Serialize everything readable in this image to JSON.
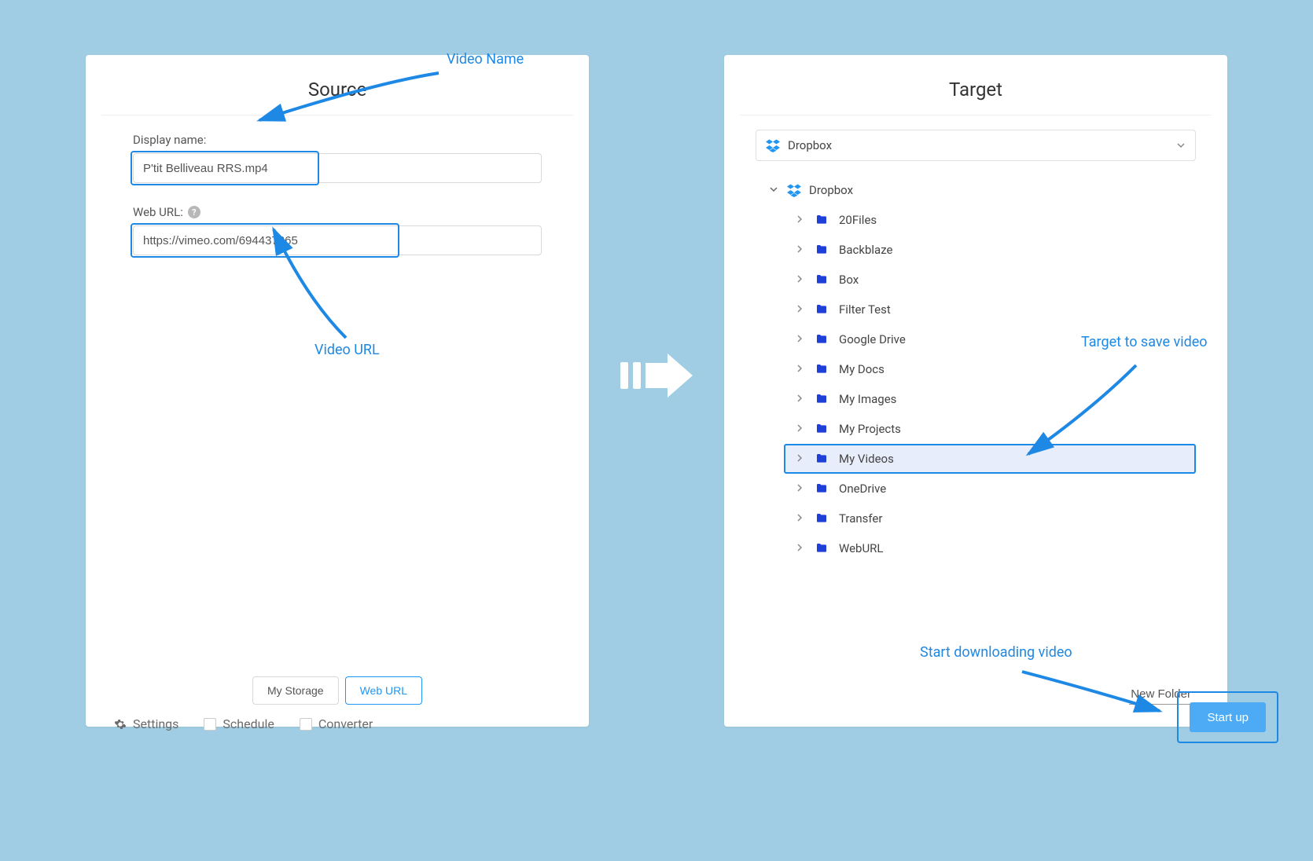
{
  "source": {
    "title": "Source",
    "display_name_label": "Display name:",
    "display_name_value": "P'tit Belliveau RRS.mp4",
    "web_url_label": "Web URL:",
    "web_url_value": "https://vimeo.com/694437265",
    "tabs": {
      "my_storage": "My Storage",
      "web_url": "Web URL"
    }
  },
  "target": {
    "title": "Target",
    "selected_provider": "Dropbox",
    "root_label": "Dropbox",
    "folders": [
      {
        "name": "20Files",
        "selected": false
      },
      {
        "name": "Backblaze",
        "selected": false
      },
      {
        "name": "Box",
        "selected": false
      },
      {
        "name": "Filter Test",
        "selected": false
      },
      {
        "name": "Google Drive",
        "selected": false
      },
      {
        "name": "My Docs",
        "selected": false
      },
      {
        "name": "My Images",
        "selected": false
      },
      {
        "name": "My Projects",
        "selected": false
      },
      {
        "name": "My Videos",
        "selected": true
      },
      {
        "name": "OneDrive",
        "selected": false
      },
      {
        "name": "Transfer",
        "selected": false
      },
      {
        "name": "WebURL",
        "selected": false
      }
    ],
    "new_folder_label": "New Folder"
  },
  "bottom": {
    "settings": "Settings",
    "schedule": "Schedule",
    "converter": "Converter",
    "startup": "Start up"
  },
  "annotations": {
    "video_name": "Video Name",
    "video_url": "Video URL",
    "target_save": "Target to save video",
    "start_download": "Start downloading video"
  },
  "icons": {
    "help": "?",
    "chevron_down": "⌄",
    "chevron_right": "›"
  }
}
